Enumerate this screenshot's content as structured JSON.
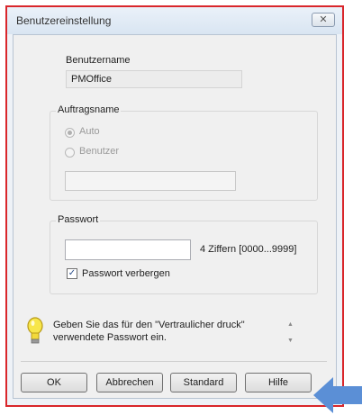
{
  "dialog": {
    "title": "Benutzereinstellung",
    "close_symbol": "✕"
  },
  "username": {
    "label": "Benutzername",
    "value": "PMOffice"
  },
  "job_name": {
    "group_label": "Auftragsname",
    "option_auto": "Auto",
    "option_user": "Benutzer",
    "selected": "Auto",
    "user_value": ""
  },
  "password": {
    "group_label": "Passwort",
    "value": "",
    "hint": "4 Ziffern [0000...9999]",
    "hide_label": "Passwort verbergen",
    "hide_checked": true,
    "check_symbol": "✓"
  },
  "info": {
    "line1": "Geben Sie das für den \"Vertraulicher druck\"",
    "line2": "verwendete Passwort ein.",
    "icon": "lightbulb-icon",
    "scroll_up": "▲",
    "scroll_down": "▼"
  },
  "buttons": {
    "ok": "OK",
    "cancel": "Abbrechen",
    "standard": "Standard",
    "help": "Hilfe"
  },
  "colors": {
    "highlight_border": "#d9262b",
    "arrow": "#5b8fd6"
  }
}
